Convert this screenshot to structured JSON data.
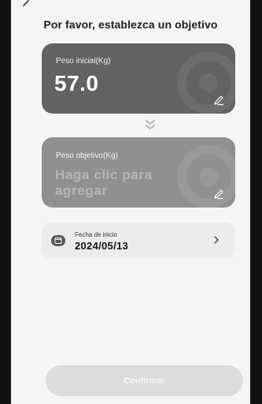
{
  "header": {
    "title": "Por favor, establezca un objetivo",
    "back_icon": "back-arrow-icon"
  },
  "initial_weight": {
    "label": "Peso inicial(Kg)",
    "value": "57.0",
    "edit_icon": "pencil-icon"
  },
  "target_weight": {
    "label": "Peso objetivo(Kg)",
    "placeholder": "Haga clic para agregar",
    "edit_icon": "pencil-icon"
  },
  "start_date": {
    "label": "Fecha de inicio",
    "value": "2024/05/13",
    "icon": "calendar-icon",
    "chevron": "chevron-right-icon"
  },
  "confirm": {
    "label": "Confirmar"
  },
  "colors": {
    "initial_card": "#626262",
    "target_card": "#909090",
    "button": "#dcdcdc",
    "background": "#f5f5f5"
  }
}
